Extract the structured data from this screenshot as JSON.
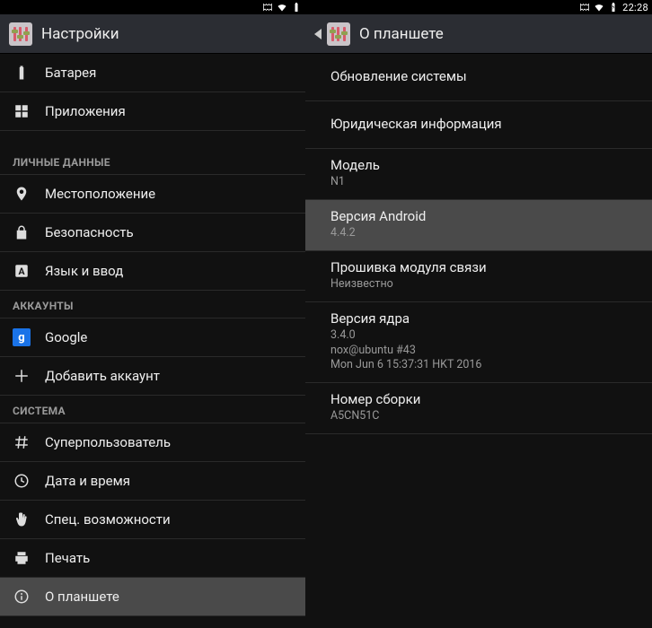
{
  "status": {
    "time": "22:28"
  },
  "left": {
    "title": "Настройки",
    "battery": "Батарея",
    "apps": "Приложения",
    "sec_personal": "ЛИЧНЫЕ ДАННЫЕ",
    "location": "Местоположение",
    "security": "Безопасность",
    "lang": "Язык и ввод",
    "sec_accounts": "АККАУНТЫ",
    "google": "Google",
    "add_account": "Добавить аккаунт",
    "sec_system": "СИСТЕМА",
    "superuser": "Суперпользователь",
    "datetime": "Дата и время",
    "accessibility": "Спец. возможности",
    "print": "Печать",
    "about": "О планшете"
  },
  "right": {
    "title": "О планшете",
    "sys_update": "Обновление системы",
    "legal": "Юридическая информация",
    "model_t": "Модель",
    "model_v": "N1",
    "android_t": "Версия Android",
    "android_v": "4.4.2",
    "baseband_t": "Прошивка модуля связи",
    "baseband_v": "Неизвестно",
    "kernel_t": "Версия ядра",
    "kernel_v": "3.4.0\nnox@ubuntu #43\nMon Jun 6 15:37:31 HKT 2016",
    "build_t": "Номер сборки",
    "build_v": "A5CN51C"
  }
}
